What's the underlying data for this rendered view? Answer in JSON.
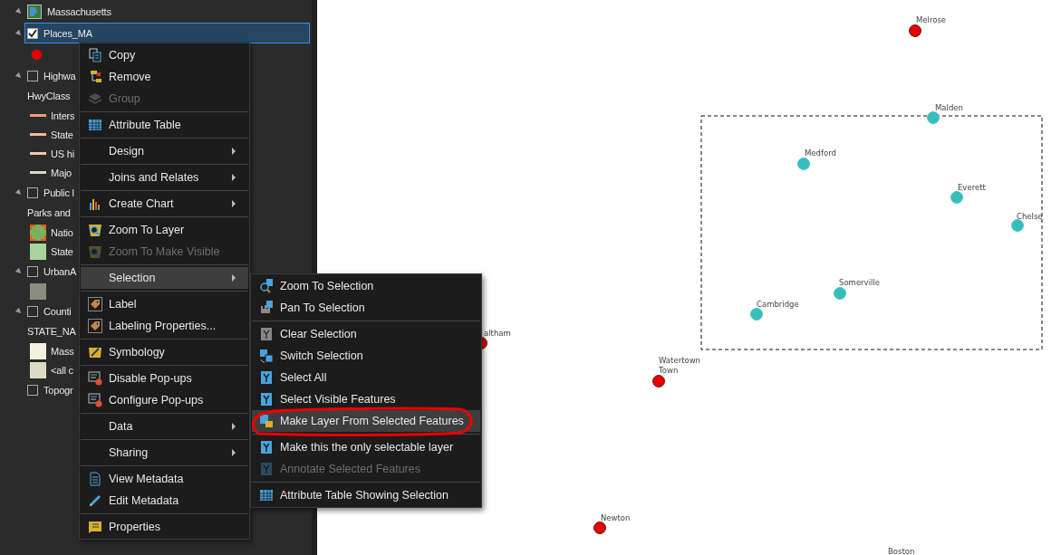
{
  "contents": {
    "map": {
      "name": "Massachusetts",
      "expanded": true,
      "children": [
        {
          "name": "Places_MA",
          "checked": true,
          "expanded": true,
          "selected": true,
          "children": [
            {
              "kind": "point",
              "color": "#e60000"
            }
          ]
        },
        {
          "name": "Highwa",
          "checked": false,
          "expanded": true,
          "selected": false,
          "children": [
            {
              "kind": "heading",
              "label": "HwyClass"
            },
            {
              "kind": "line",
              "label": "Inters",
              "color": "#e8a07a"
            },
            {
              "kind": "line",
              "label": "State",
              "color": "#f0b8a0"
            },
            {
              "kind": "line",
              "label": "US hi",
              "color": "#f5c8b0"
            },
            {
              "kind": "line",
              "label": "Majo",
              "color": "#d8d8c8"
            }
          ]
        },
        {
          "name": "Public l",
          "checked": false,
          "expanded": true,
          "selected": false,
          "children": [
            {
              "kind": "heading",
              "label": "Parks and"
            },
            {
              "kind": "outlined-fill",
              "label": "Natio",
              "color": "#7fae5f"
            },
            {
              "kind": "fill",
              "label": "State",
              "color": "#a8d39c"
            }
          ]
        },
        {
          "name": "UrbanA",
          "checked": false,
          "expanded": true,
          "selected": false,
          "children": [
            {
              "kind": "fill",
              "color": "#8a8c7e"
            }
          ]
        },
        {
          "name": "Counti",
          "checked": false,
          "expanded": true,
          "selected": false,
          "children": [
            {
              "kind": "heading",
              "label": "STATE_NA"
            },
            {
              "kind": "fill",
              "label": "Mass",
              "color": "#f2f2dc"
            },
            {
              "kind": "fill",
              "label": "<all c",
              "color": "#dcdcc4"
            }
          ]
        },
        {
          "name": "Topogr",
          "checked": false,
          "selected": false
        }
      ]
    }
  },
  "context_menu": {
    "groups": [
      [
        {
          "label": "Copy",
          "disabled": false
        },
        {
          "label": "Remove",
          "disabled": false
        },
        {
          "label": "Group",
          "disabled": true
        }
      ],
      [
        {
          "label": "Attribute Table",
          "disabled": false
        }
      ],
      [
        {
          "label": "Design",
          "disabled": false,
          "submenu": true
        }
      ],
      [
        {
          "label": "Joins and Relates",
          "disabled": false,
          "submenu": true
        }
      ],
      [
        {
          "label": "Create Chart",
          "disabled": false,
          "submenu": true
        }
      ],
      [
        {
          "label": "Zoom To Layer",
          "disabled": false
        },
        {
          "label": "Zoom To Make Visible",
          "disabled": true
        }
      ],
      [
        {
          "label": "Selection",
          "disabled": false,
          "submenu": true,
          "selected": true
        }
      ],
      [
        {
          "label": "Label",
          "disabled": false
        },
        {
          "label": "Labeling Properties...",
          "disabled": false
        }
      ],
      [
        {
          "label": "Symbology",
          "disabled": false
        }
      ],
      [
        {
          "label": "Disable Pop-ups",
          "disabled": false
        },
        {
          "label": "Configure Pop-ups",
          "disabled": false
        }
      ],
      [
        {
          "label": "Data",
          "disabled": false,
          "submenu": true
        }
      ],
      [
        {
          "label": "Sharing",
          "disabled": false,
          "submenu": true
        }
      ],
      [
        {
          "label": "View Metadata",
          "disabled": false
        },
        {
          "label": "Edit Metadata",
          "disabled": false
        }
      ],
      [
        {
          "label": "Properties",
          "disabled": false
        }
      ]
    ]
  },
  "submenu": {
    "groups": [
      [
        {
          "label": "Zoom To Selection",
          "disabled": false
        },
        {
          "label": "Pan To Selection",
          "disabled": false
        }
      ],
      [
        {
          "label": "Clear Selection",
          "disabled": false
        },
        {
          "label": "Switch Selection",
          "disabled": false
        },
        {
          "label": "Select All",
          "disabled": false
        },
        {
          "label": "Select Visible Features",
          "disabled": false
        },
        {
          "label": "Make Layer From Selected Features",
          "disabled": false,
          "selected": true
        }
      ],
      [
        {
          "label": "Make this the only selectable layer",
          "disabled": false
        },
        {
          "label": "Annotate Selected Features",
          "disabled": true
        }
      ],
      [
        {
          "label": "Attribute Table Showing Selection",
          "disabled": false
        }
      ]
    ]
  },
  "map": {
    "places": [
      {
        "label_lines": [
          "Melrose"
        ],
        "selected": false
      },
      {
        "label_lines": [
          "Malden"
        ],
        "selected": true
      },
      {
        "label_lines": [
          "Medford"
        ],
        "selected": true
      },
      {
        "label_lines": [
          "Everett"
        ],
        "selected": true
      },
      {
        "label_lines": [
          "Chelse"
        ],
        "selected": true
      },
      {
        "label_lines": [
          "Somerville"
        ],
        "selected": true
      },
      {
        "label_lines": [
          "Cambridge"
        ],
        "selected": true
      },
      {
        "label_lines": [
          "altham"
        ],
        "selected": false
      },
      {
        "label_lines": [
          "Watertown",
          "Town"
        ],
        "selected": false
      },
      {
        "label_lines": [
          "Newton"
        ],
        "selected": false
      },
      {
        "label_lines": [
          "Boston"
        ]
      }
    ]
  }
}
